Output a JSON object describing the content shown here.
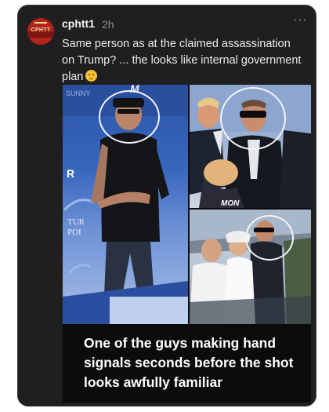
{
  "post": {
    "username": "cphtt1",
    "time": "2h",
    "more_label": "···",
    "text": "Same person as at the claimed assassination on Trump? ... the looks like internal government plan",
    "emoji": "thinking-face-emoji"
  },
  "avatar": {
    "text": "CPHTT"
  },
  "media": {
    "caption": "One of the guys making hand signals seconds before the shot looks awfully familiar",
    "left_photo_fragments": [
      "R",
      "TUR",
      "POI"
    ]
  },
  "colors": {
    "card_bg": "#1f1f21",
    "text": "#ececec",
    "muted": "#8e8e93",
    "circle": "#f4f4f4"
  }
}
